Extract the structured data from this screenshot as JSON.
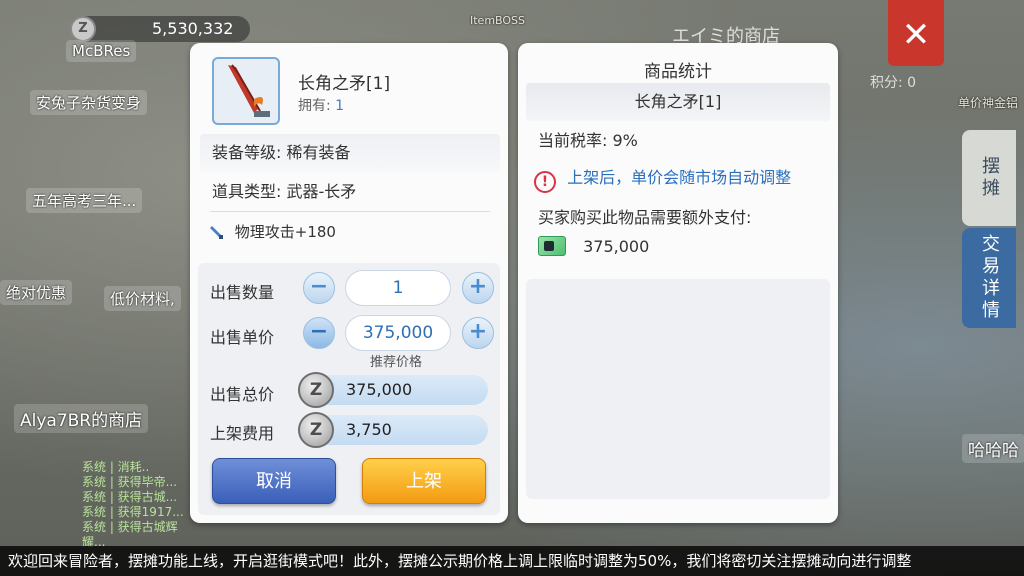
{
  "background": {
    "zeny_total": "5,530,332",
    "zeny_coin": "Z",
    "shop_title": "エイミ的商店",
    "score": "积分: 0",
    "close_glyph": "✕",
    "tab_stall": "摆摊",
    "tab_trade": "交易详情",
    "labels": [
      "McBRes",
      "安兔子杂货变身",
      "五年高考三年...",
      "绝对优惠",
      "低价材料,",
      "Alya7BR的商店",
      "哈哈哈",
      "单价神金铝",
      "ItemBOSS"
    ],
    "log_lines": [
      "系统 | 消耗..",
      "系统 | 获得毕帝...",
      "系统 | 获得古城...",
      "系统 | 获得1917...",
      "系统 | 获得古城辉耀..."
    ]
  },
  "item": {
    "name": "长角之矛[1]",
    "own_label": "拥有:",
    "own_value": "1",
    "grade_label": "装备等级:",
    "grade_value": "稀有装备",
    "type_label": "道具类型:",
    "type_value": "武器-长矛",
    "bonus": "物理攻击+180"
  },
  "form": {
    "qty_label": "出售数量",
    "qty_value": "1",
    "price_label": "出售单价",
    "price_value": "375,000",
    "price_hint": "推荐价格",
    "total_label": "出售总价",
    "total_value": "375,000",
    "fee_label": "上架费用",
    "fee_value": "3,750",
    "minus": "−",
    "plus": "+",
    "coin": "Z"
  },
  "buttons": {
    "cancel": "取消",
    "list": "上架"
  },
  "stats": {
    "title": "商品统计",
    "item_name": "长角之矛[1]",
    "tax": "当前税率: 9%",
    "warning": "上架后，单价会随市场自动调整",
    "warning_icon": "!",
    "buyer_note": "买家购买此物品需要额外支付:",
    "buyer_amount": "375,000"
  },
  "ticker": "欢迎回来冒险者，摆摊功能上线，开启逛街模式吧！此外，摆摊公示期价格上调上限临时调整为50%，我们将密切关注摆摊动向进行调整",
  "colors": {
    "accent_blue": "#3b7fc4",
    "cancel_blue": "#3a5fb8",
    "list_orange": "#f39b12",
    "warning_red": "#d8334a",
    "close_red": "#c9372c"
  }
}
